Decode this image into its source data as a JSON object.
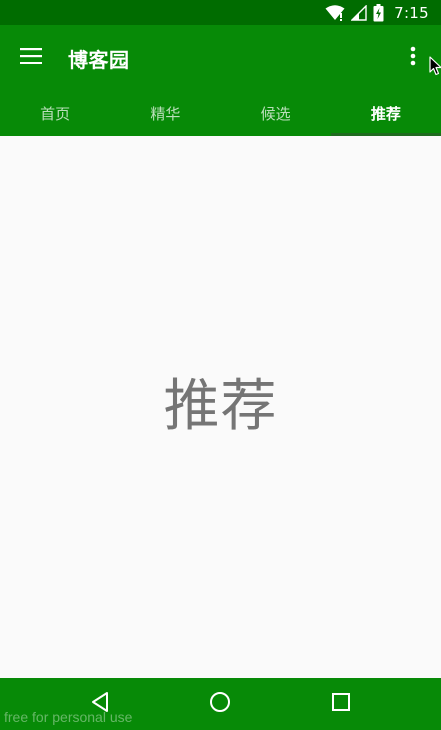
{
  "status_bar": {
    "time": "7:15",
    "icons": [
      "wifi-icon",
      "signal-icon",
      "battery-charging-icon"
    ]
  },
  "app_bar": {
    "title": "博客园",
    "menu_icon": "hamburger-menu-icon",
    "overflow_icon": "more-vertical-icon"
  },
  "tabs": [
    {
      "label": "首页",
      "active": false
    },
    {
      "label": "精华",
      "active": false
    },
    {
      "label": "候选",
      "active": false
    },
    {
      "label": "推荐",
      "active": true
    }
  ],
  "content": {
    "text": "推荐"
  },
  "nav_bar": {
    "icons": [
      "back-triangle-icon",
      "home-circle-icon",
      "recents-square-icon"
    ]
  },
  "watermark": "free for personal use",
  "colors": {
    "status_bar": "#006c00",
    "primary": "#078a07",
    "background": "#fafafa",
    "content_text": "#757575"
  }
}
